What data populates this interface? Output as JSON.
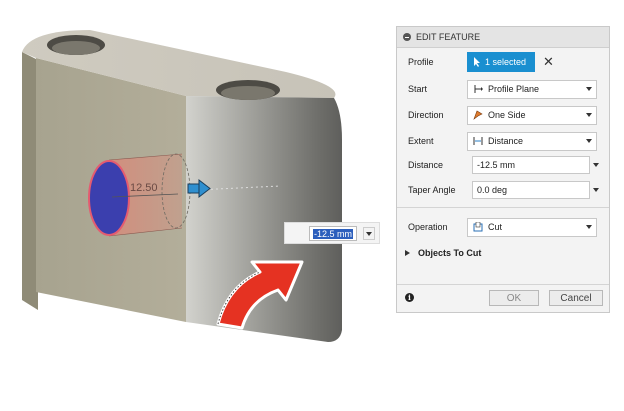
{
  "viewport": {
    "dimension_label": "12.50",
    "floating_input_value": "-12.5 mm"
  },
  "panel": {
    "title": "EDIT FEATURE",
    "profile": {
      "label": "Profile",
      "selected": "1 selected"
    },
    "start": {
      "label": "Start",
      "value": "Profile Plane"
    },
    "direction": {
      "label": "Direction",
      "value": "One Side"
    },
    "extent": {
      "label": "Extent",
      "value": "Distance"
    },
    "distance": {
      "label": "Distance",
      "value": "-12.5 mm"
    },
    "taper": {
      "label": "Taper Angle",
      "value": "0.0 deg"
    },
    "operation": {
      "label": "Operation",
      "value": "Cut"
    },
    "objects_to_cut": "Objects To Cut",
    "ok_label": "OK",
    "cancel_label": "Cancel"
  },
  "colors": {
    "accent": "#1a8fd0",
    "cut_arrow": "#e53222",
    "profile_fill": "#3b3fae",
    "extrude_preview": "#d98a7a"
  }
}
